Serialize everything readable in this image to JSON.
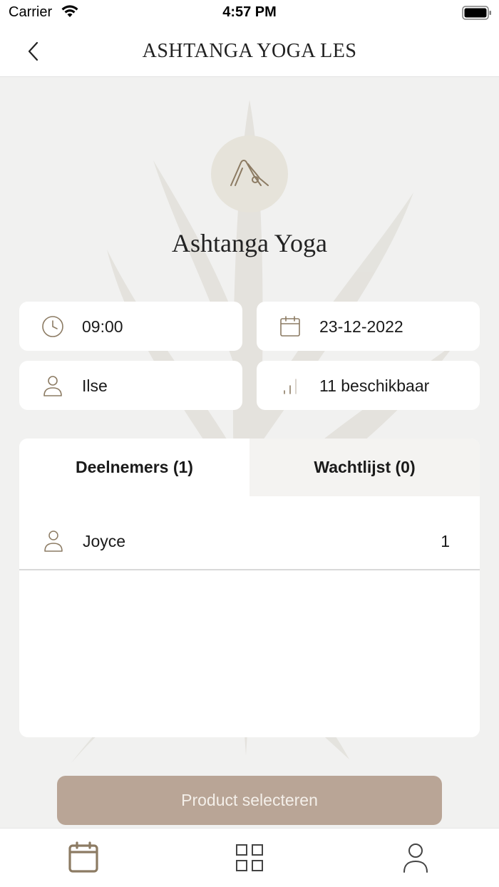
{
  "status_bar": {
    "carrier": "Carrier",
    "time": "4:57 PM"
  },
  "header": {
    "title": "ASHTANGA YOGA LES",
    "back_icon": "chevron-left-icon"
  },
  "class": {
    "icon": "yoga-pose-icon",
    "name": "Ashtanga Yoga"
  },
  "info": {
    "time": {
      "icon": "clock-icon",
      "value": "09:00"
    },
    "date": {
      "icon": "calendar-icon",
      "value": "23-12-2022"
    },
    "teacher": {
      "icon": "person-icon",
      "value": "Ilse"
    },
    "availability": {
      "icon": "signal-bars-icon",
      "value": "11 beschikbaar"
    }
  },
  "tabs": [
    {
      "label": "Deelnemers (1)",
      "active": true
    },
    {
      "label": "Wachtlijst (0)",
      "active": false
    }
  ],
  "participants": [
    {
      "icon": "person-icon",
      "name": "Joyce",
      "count": "1"
    }
  ],
  "action_button": {
    "label": "Product selecteren"
  },
  "tab_bar": [
    {
      "icon": "calendar-icon",
      "active": true
    },
    {
      "icon": "grid-icon",
      "active": false
    },
    {
      "icon": "profile-icon",
      "active": false
    }
  ],
  "colors": {
    "accent": "#8c7b63",
    "button": "#b9a596",
    "background": "#f1f1f0",
    "icon_circle": "#e6e3da"
  }
}
